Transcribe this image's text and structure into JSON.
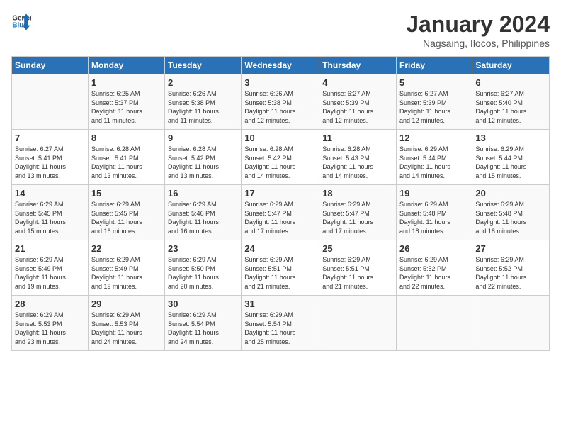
{
  "header": {
    "logo_line1": "General",
    "logo_line2": "Blue",
    "month_title": "January 2024",
    "subtitle": "Nagsaing, Ilocos, Philippines"
  },
  "columns": [
    "Sunday",
    "Monday",
    "Tuesday",
    "Wednesday",
    "Thursday",
    "Friday",
    "Saturday"
  ],
  "weeks": [
    [
      {
        "day": "",
        "info": ""
      },
      {
        "day": "1",
        "info": "Sunrise: 6:25 AM\nSunset: 5:37 PM\nDaylight: 11 hours\nand 11 minutes."
      },
      {
        "day": "2",
        "info": "Sunrise: 6:26 AM\nSunset: 5:38 PM\nDaylight: 11 hours\nand 11 minutes."
      },
      {
        "day": "3",
        "info": "Sunrise: 6:26 AM\nSunset: 5:38 PM\nDaylight: 11 hours\nand 12 minutes."
      },
      {
        "day": "4",
        "info": "Sunrise: 6:27 AM\nSunset: 5:39 PM\nDaylight: 11 hours\nand 12 minutes."
      },
      {
        "day": "5",
        "info": "Sunrise: 6:27 AM\nSunset: 5:39 PM\nDaylight: 11 hours\nand 12 minutes."
      },
      {
        "day": "6",
        "info": "Sunrise: 6:27 AM\nSunset: 5:40 PM\nDaylight: 11 hours\nand 12 minutes."
      }
    ],
    [
      {
        "day": "7",
        "info": "Sunrise: 6:27 AM\nSunset: 5:41 PM\nDaylight: 11 hours\nand 13 minutes."
      },
      {
        "day": "8",
        "info": "Sunrise: 6:28 AM\nSunset: 5:41 PM\nDaylight: 11 hours\nand 13 minutes."
      },
      {
        "day": "9",
        "info": "Sunrise: 6:28 AM\nSunset: 5:42 PM\nDaylight: 11 hours\nand 13 minutes."
      },
      {
        "day": "10",
        "info": "Sunrise: 6:28 AM\nSunset: 5:42 PM\nDaylight: 11 hours\nand 14 minutes."
      },
      {
        "day": "11",
        "info": "Sunrise: 6:28 AM\nSunset: 5:43 PM\nDaylight: 11 hours\nand 14 minutes."
      },
      {
        "day": "12",
        "info": "Sunrise: 6:29 AM\nSunset: 5:44 PM\nDaylight: 11 hours\nand 14 minutes."
      },
      {
        "day": "13",
        "info": "Sunrise: 6:29 AM\nSunset: 5:44 PM\nDaylight: 11 hours\nand 15 minutes."
      }
    ],
    [
      {
        "day": "14",
        "info": "Sunrise: 6:29 AM\nSunset: 5:45 PM\nDaylight: 11 hours\nand 15 minutes."
      },
      {
        "day": "15",
        "info": "Sunrise: 6:29 AM\nSunset: 5:45 PM\nDaylight: 11 hours\nand 16 minutes."
      },
      {
        "day": "16",
        "info": "Sunrise: 6:29 AM\nSunset: 5:46 PM\nDaylight: 11 hours\nand 16 minutes."
      },
      {
        "day": "17",
        "info": "Sunrise: 6:29 AM\nSunset: 5:47 PM\nDaylight: 11 hours\nand 17 minutes."
      },
      {
        "day": "18",
        "info": "Sunrise: 6:29 AM\nSunset: 5:47 PM\nDaylight: 11 hours\nand 17 minutes."
      },
      {
        "day": "19",
        "info": "Sunrise: 6:29 AM\nSunset: 5:48 PM\nDaylight: 11 hours\nand 18 minutes."
      },
      {
        "day": "20",
        "info": "Sunrise: 6:29 AM\nSunset: 5:48 PM\nDaylight: 11 hours\nand 18 minutes."
      }
    ],
    [
      {
        "day": "21",
        "info": "Sunrise: 6:29 AM\nSunset: 5:49 PM\nDaylight: 11 hours\nand 19 minutes."
      },
      {
        "day": "22",
        "info": "Sunrise: 6:29 AM\nSunset: 5:49 PM\nDaylight: 11 hours\nand 19 minutes."
      },
      {
        "day": "23",
        "info": "Sunrise: 6:29 AM\nSunset: 5:50 PM\nDaylight: 11 hours\nand 20 minutes."
      },
      {
        "day": "24",
        "info": "Sunrise: 6:29 AM\nSunset: 5:51 PM\nDaylight: 11 hours\nand 21 minutes."
      },
      {
        "day": "25",
        "info": "Sunrise: 6:29 AM\nSunset: 5:51 PM\nDaylight: 11 hours\nand 21 minutes."
      },
      {
        "day": "26",
        "info": "Sunrise: 6:29 AM\nSunset: 5:52 PM\nDaylight: 11 hours\nand 22 minutes."
      },
      {
        "day": "27",
        "info": "Sunrise: 6:29 AM\nSunset: 5:52 PM\nDaylight: 11 hours\nand 22 minutes."
      }
    ],
    [
      {
        "day": "28",
        "info": "Sunrise: 6:29 AM\nSunset: 5:53 PM\nDaylight: 11 hours\nand 23 minutes."
      },
      {
        "day": "29",
        "info": "Sunrise: 6:29 AM\nSunset: 5:53 PM\nDaylight: 11 hours\nand 24 minutes."
      },
      {
        "day": "30",
        "info": "Sunrise: 6:29 AM\nSunset: 5:54 PM\nDaylight: 11 hours\nand 24 minutes."
      },
      {
        "day": "31",
        "info": "Sunrise: 6:29 AM\nSunset: 5:54 PM\nDaylight: 11 hours\nand 25 minutes."
      },
      {
        "day": "",
        "info": ""
      },
      {
        "day": "",
        "info": ""
      },
      {
        "day": "",
        "info": ""
      }
    ]
  ]
}
